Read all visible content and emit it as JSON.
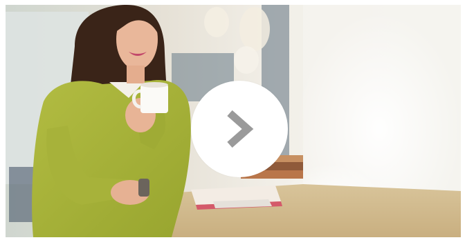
{
  "slide": {
    "image_alt": "",
    "icons": {
      "next": "chevron-right-icon"
    }
  },
  "colors": {
    "button_bg": "#ffffff",
    "chevron": "#9a9a9a",
    "sweater": "#a9b53a",
    "background_light": "#f1eee7"
  }
}
